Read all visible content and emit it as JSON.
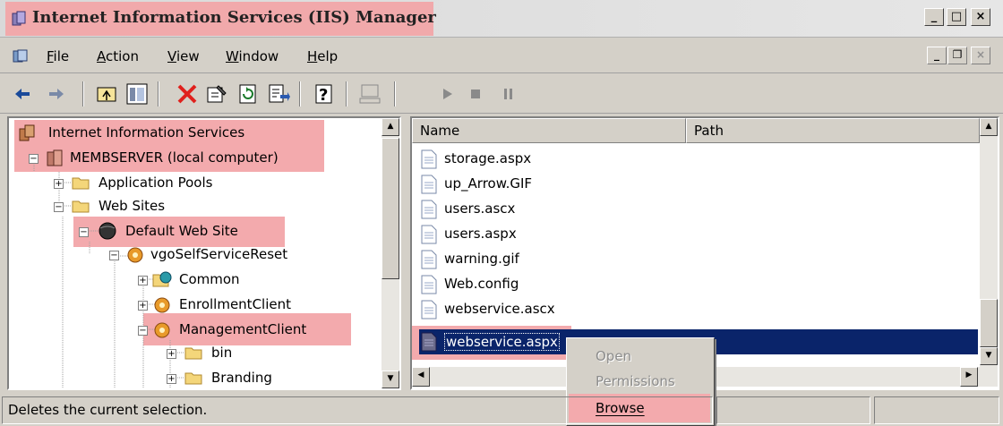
{
  "window": {
    "title": "Internet Information Services (IIS) Manager",
    "highlight_color": "#f3aaad",
    "controls": {
      "minimize": "_",
      "maximize": "□",
      "close": "×"
    }
  },
  "menubar": {
    "items": [
      {
        "label": "File",
        "icon": "none"
      },
      {
        "label": "Action"
      },
      {
        "label": "View"
      },
      {
        "label": "Window"
      },
      {
        "label": "Help"
      }
    ],
    "mdi_controls": {
      "minimize": "_",
      "restore": "❐",
      "close": "×"
    }
  },
  "toolbar": {
    "buttons": [
      "back-icon",
      "forward-icon",
      "up-folder-icon",
      "show-tree-icon",
      "delete-icon",
      "properties-icon",
      "refresh-icon",
      "export-list-icon",
      "help-icon",
      "computer-icon",
      "play-icon",
      "stop-icon",
      "pause-icon"
    ],
    "delete_color": "#e0201c"
  },
  "tree": {
    "nodes": [
      {
        "label": "Internet Information Services",
        "level": 0,
        "highlighted": true
      },
      {
        "label": "MEMBSERVER (local computer)",
        "level": 1,
        "highlighted": true,
        "expander": "−"
      },
      {
        "label": "Application Pools",
        "level": 2,
        "expander": "+"
      },
      {
        "label": "Web Sites",
        "level": 2,
        "expander": "−"
      },
      {
        "label": "Default Web Site",
        "level": 3,
        "highlighted": true,
        "expander": "−"
      },
      {
        "label": "vgoSelfServiceReset",
        "level": 4,
        "expander": "−"
      },
      {
        "label": "Common",
        "level": 5,
        "expander": "+"
      },
      {
        "label": "EnrollmentClient",
        "level": 5,
        "expander": "+"
      },
      {
        "label": "ManagementClient",
        "level": 5,
        "highlighted": true,
        "expander": "−"
      },
      {
        "label": "bin",
        "level": 6,
        "expander": "+"
      },
      {
        "label": "Branding",
        "level": 6,
        "expander": "+"
      }
    ]
  },
  "list": {
    "columns": [
      "Name",
      "Path"
    ],
    "rows": [
      "storage.aspx",
      "up_Arrow.GIF",
      "users.ascx",
      "users.aspx",
      "warning.gif",
      "Web.config",
      "webservice.ascx",
      "webservice.aspx"
    ],
    "selected_row": "webservice.aspx",
    "selection_color": "#0a246a"
  },
  "context_menu": {
    "items": [
      {
        "label": "Open",
        "enabled": false
      },
      {
        "label": "Permissions",
        "enabled": false
      },
      {
        "label": "Browse",
        "enabled": true,
        "highlighted": true
      }
    ]
  },
  "status": {
    "message": "Deletes the current selection."
  }
}
